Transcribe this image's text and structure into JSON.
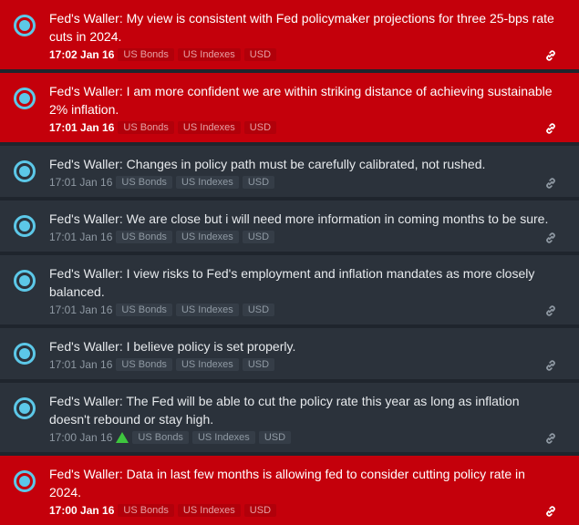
{
  "feed": {
    "items": [
      {
        "headline": "Fed's Waller: My view is consistent with Fed policymaker projections for three 25-bps rate cuts in 2024.",
        "time": "17:02 Jan 16",
        "tags": [
          "US Bonds",
          "US Indexes",
          "USD"
        ],
        "highlighted": true,
        "indicator": ""
      },
      {
        "headline": "Fed's Waller: I am more confident we are within striking distance of achieving sustainable 2% inflation.",
        "time": "17:01 Jan 16",
        "tags": [
          "US Bonds",
          "US Indexes",
          "USD"
        ],
        "highlighted": true,
        "indicator": ""
      },
      {
        "headline": "Fed's Waller: Changes in policy path must be carefully calibrated, not rushed.",
        "time": "17:01 Jan 16",
        "tags": [
          "US Bonds",
          "US Indexes",
          "USD"
        ],
        "highlighted": false,
        "indicator": ""
      },
      {
        "headline": "Fed's Waller: We are close but i will need more information in coming months to be sure.",
        "time": "17:01 Jan 16",
        "tags": [
          "US Bonds",
          "US Indexes",
          "USD"
        ],
        "highlighted": false,
        "indicator": ""
      },
      {
        "headline": "Fed's Waller: I view risks to Fed's employment and inflation mandates as more closely balanced.",
        "time": "17:01 Jan 16",
        "tags": [
          "US Bonds",
          "US Indexes",
          "USD"
        ],
        "highlighted": false,
        "indicator": ""
      },
      {
        "headline": "Fed's Waller: I believe policy is set properly.",
        "time": "17:01 Jan 16",
        "tags": [
          "US Bonds",
          "US Indexes",
          "USD"
        ],
        "highlighted": false,
        "indicator": ""
      },
      {
        "headline": "Fed's Waller: The Fed will be able to cut the policy rate this year as long as inflation doesn't rebound or stay high.",
        "time": "17:00 Jan 16",
        "tags": [
          "US Bonds",
          "US Indexes",
          "USD"
        ],
        "highlighted": false,
        "indicator": "green-up-triangle-icon"
      },
      {
        "headline": "Fed's Waller: Data in last few months is allowing fed to consider cutting policy rate in 2024.",
        "time": "17:00 Jan 16",
        "tags": [
          "US Bonds",
          "US Indexes",
          "USD"
        ],
        "highlighted": true,
        "indicator": ""
      }
    ]
  },
  "icons": {
    "read_marker": "radio-circle-icon",
    "link": "link-icon",
    "sentiment": "green-up-triangle-icon"
  },
  "colors": {
    "highlight_bg": "#c4000b",
    "item_bg": "#2b323b",
    "accent": "#5cc8e8",
    "positive": "#3ec63e"
  }
}
